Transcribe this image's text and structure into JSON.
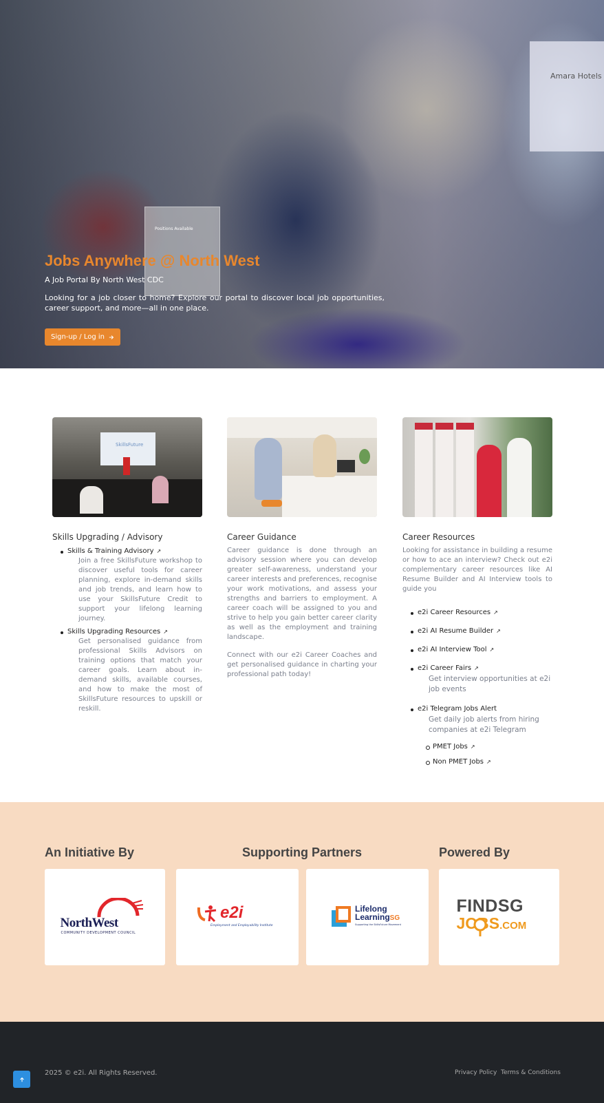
{
  "hero": {
    "title": "Jobs Anywhere @ North West",
    "subtitle": "A Job Portal By North West CDC",
    "description": "Looking for a job closer to home? Explore our portal to discover local job opportunities, career support, and more—all in one place.",
    "cta_label": "Sign-up / Log in",
    "photo_sign_title": "Positions Available",
    "photo_banner_text": "Amara Hotels & R"
  },
  "cards": [
    {
      "title": "Skills Upgrading / Advisory",
      "items": [
        {
          "label": "Skills & Training Advisory",
          "description": "Join a free SkillsFuture workshop to discover useful tools for career planning, explore in-demand skills and job trends, and learn how to use your SkillsFuture Credit to support your lifelong learning journey."
        },
        {
          "label": "Skills Upgrading Resources",
          "description": "Get personalised guidance from professional Skills Advisors on training options that match your career goals. Learn about in-demand skills, available courses, and how to make the most of SkillsFuture resources to upskill or reskill."
        }
      ]
    },
    {
      "title": "Career Guidance",
      "paragraph1": "Career guidance is done through an advisory session where you can develop greater self-awareness, understand your career interests and preferences, recognise your work motivations, and assess your strengths and barriers to employment. A career coach will be assigned to you and strive to help you gain better career clarity as well as the employment and training landscape.",
      "paragraph2": "Connect with our e2i Career Coaches and get personalised guidance in charting your professional path today!"
    },
    {
      "title": "Career Resources",
      "intro": "Looking for assistance in building a resume or how to ace an interview? Check out e2i complementary career resources like AI Resume Builder and AI Interview tools to guide you",
      "links": [
        {
          "label": "e2i Career Resources"
        },
        {
          "label": "e2i AI Resume Builder"
        },
        {
          "label": "e2i AI Interview Tool"
        },
        {
          "label": "e2i Career Fairs",
          "description": "Get interview opportunities at e2i job events"
        },
        {
          "label": "e2i Telegram Jobs Alert",
          "description": "Get daily job alerts from hiring companies at e2i Telegram"
        }
      ],
      "sub_links": [
        {
          "label": "PMET Jobs"
        },
        {
          "label": "Non PMET Jobs"
        }
      ]
    }
  ],
  "card_images": {
    "presentation_screen_text": "SkillsFuture"
  },
  "partners": {
    "initiative_heading": "An Initiative By",
    "supporting_heading": "Supporting Partners",
    "powered_heading": "Powered By",
    "logos": {
      "northwest_main": "NorthWest",
      "northwest_sub": "COMMUNITY DEVELOPMENT COUNCIL",
      "e2i_main": "e2i",
      "e2i_sub": "Employment and Employability Institute",
      "lifelong_line1": "Lifelong",
      "lifelong_line2": "Learning",
      "lifelong_sg": "SG",
      "lifelong_sub": "Supporting the SkillsFuture Movement",
      "findsg_line1": "FINDSG",
      "findsg_line2": "JOBS",
      "findsg_suffix": ".COM"
    }
  },
  "footer": {
    "copyright": "2025 © e2i. All Rights Reserved.",
    "privacy": "Privacy Policy",
    "terms": "Terms & Conditions"
  },
  "colors": {
    "accent": "#e8872d",
    "partners_bg": "#f8dbc2",
    "footer_bg": "#212428",
    "back_to_top": "#2d8fe0"
  },
  "icons": {
    "cta": "arrow-right-icon",
    "external": "external-link-icon",
    "back_to_top": "arrow-up-icon"
  }
}
